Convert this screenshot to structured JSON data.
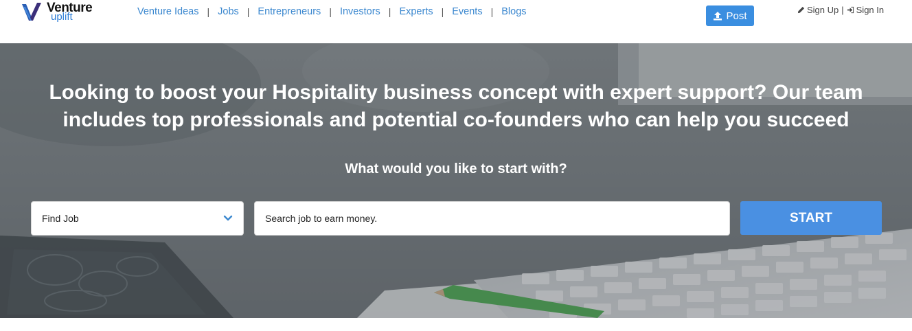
{
  "brand": {
    "word1": "Venture",
    "word2": "uplift"
  },
  "nav": {
    "items": [
      {
        "label": "Venture Ideas"
      },
      {
        "label": "Jobs"
      },
      {
        "label": "Entrepreneurs"
      },
      {
        "label": "Investors"
      },
      {
        "label": "Experts"
      },
      {
        "label": "Events"
      },
      {
        "label": "Blogs"
      }
    ],
    "separator": "|"
  },
  "post_button": {
    "label": "Post",
    "icon": "upload-icon"
  },
  "auth": {
    "signup_label": "Sign Up",
    "signin_label": "Sign In",
    "separator": "|",
    "signup_icon": "pencil-icon",
    "signin_icon": "sign-in-icon"
  },
  "hero": {
    "headline": "Looking to boost your Hospitality business concept with expert support? Our team includes top professionals and potential co-founders who can help you succeed",
    "subhead": "What would you like to start with?",
    "select": {
      "value": "Find Job",
      "icon": "chevron-down-icon"
    },
    "search": {
      "placeholder": "Search job to earn money."
    },
    "start_label": "START"
  },
  "colors": {
    "accent": "#4a90e2",
    "nav_link": "#3a87cf",
    "post_button": "#3a8ee0"
  }
}
